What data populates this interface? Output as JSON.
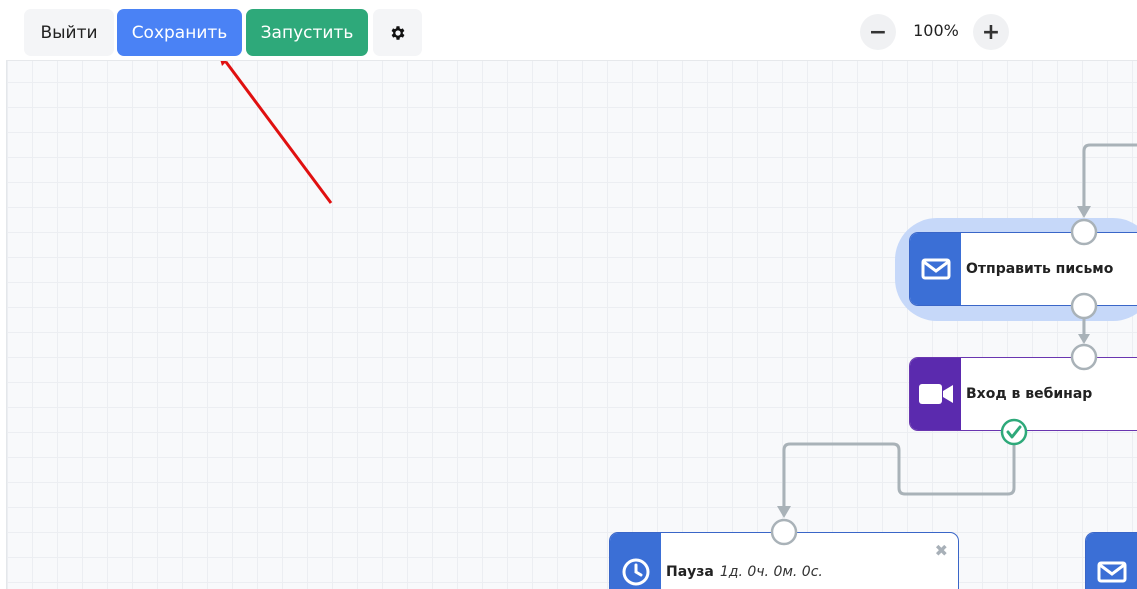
{
  "toolbar": {
    "exit_label": "Выйти",
    "save_label": "Сохранить",
    "run_label": "Запустить",
    "settings_icon": "gear-icon",
    "zoom_minus": "−",
    "zoom_level": "100%",
    "zoom_plus": "+"
  },
  "nodes": {
    "email": {
      "icon": "envelope-icon",
      "label": "Отправить письмо"
    },
    "webinar": {
      "icon": "video-camera-icon",
      "label": "Вход в вебинар"
    },
    "pause": {
      "icon": "clock-icon",
      "label": "Пауза",
      "value": "1д. 0ч. 0м. 0с."
    },
    "email2": {
      "icon": "envelope-icon"
    }
  },
  "colors": {
    "save": "#4a82f5",
    "run": "#2ea97a",
    "email_node": "#3b6fd6",
    "webinar_node": "#5b2aae",
    "annotation_arrow": "#e01010",
    "connector": "#a9b2b8",
    "success_check": "#2ea97a"
  }
}
